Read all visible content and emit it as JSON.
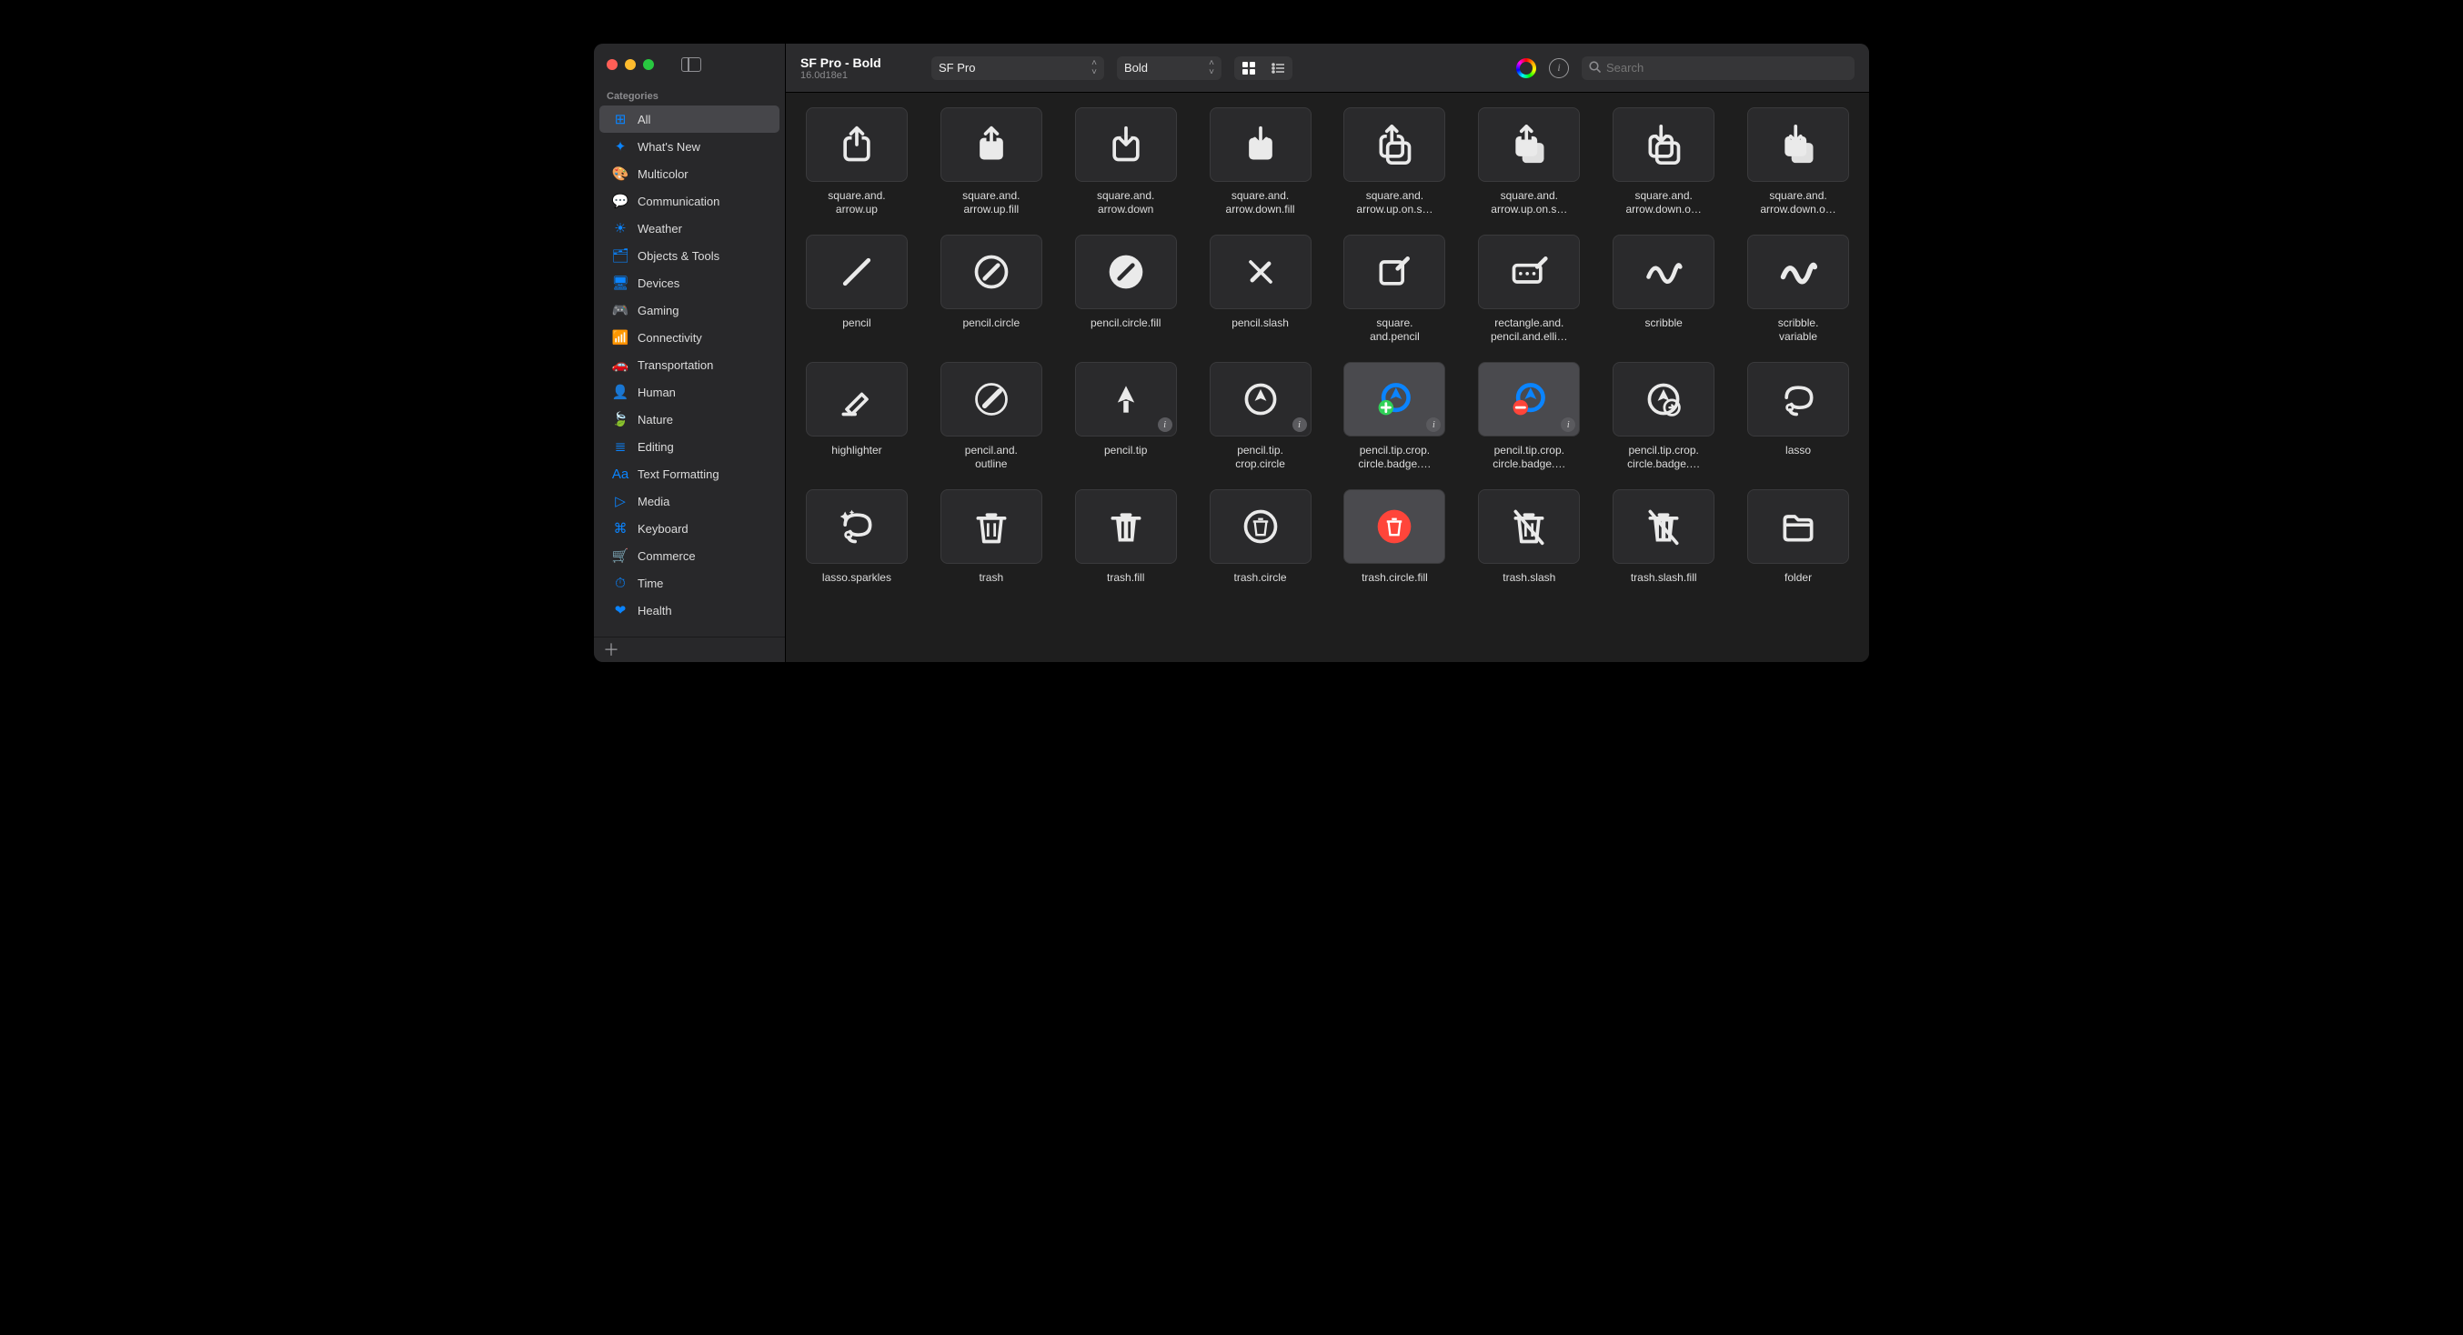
{
  "window": {
    "title": "SF Pro - Bold",
    "subtitle": "16.0d18e1"
  },
  "toolbar": {
    "font": "SF Pro",
    "weight": "Bold",
    "view_mode": "grid",
    "search_placeholder": "Search"
  },
  "sidebar": {
    "section_label": "Categories",
    "items": [
      {
        "id": "all",
        "label": "All",
        "selected": true
      },
      {
        "id": "whats-new",
        "label": "What's New",
        "selected": false
      },
      {
        "id": "multicolor",
        "label": "Multicolor",
        "selected": false
      },
      {
        "id": "communication",
        "label": "Communication",
        "selected": false
      },
      {
        "id": "weather",
        "label": "Weather",
        "selected": false
      },
      {
        "id": "objects-tools",
        "label": "Objects & Tools",
        "selected": false
      },
      {
        "id": "devices",
        "label": "Devices",
        "selected": false
      },
      {
        "id": "gaming",
        "label": "Gaming",
        "selected": false
      },
      {
        "id": "connectivity",
        "label": "Connectivity",
        "selected": false
      },
      {
        "id": "transportation",
        "label": "Transportation",
        "selected": false
      },
      {
        "id": "human",
        "label": "Human",
        "selected": false
      },
      {
        "id": "nature",
        "label": "Nature",
        "selected": false
      },
      {
        "id": "editing",
        "label": "Editing",
        "selected": false
      },
      {
        "id": "text-formatting",
        "label": "Text Formatting",
        "selected": false
      },
      {
        "id": "media",
        "label": "Media",
        "selected": false
      },
      {
        "id": "keyboard",
        "label": "Keyboard",
        "selected": false
      },
      {
        "id": "commerce",
        "label": "Commerce",
        "selected": false
      },
      {
        "id": "time",
        "label": "Time",
        "selected": false
      },
      {
        "id": "health",
        "label": "Health",
        "selected": false
      }
    ]
  },
  "symbols": [
    {
      "name": "square.and.arrow.up",
      "display": "square.and.\narrow.up",
      "icon": "share-up",
      "info": false,
      "selected": false
    },
    {
      "name": "square.and.arrow.up.fill",
      "display": "square.and.\narrow.up.fill",
      "icon": "share-up-fill",
      "info": false,
      "selected": false
    },
    {
      "name": "square.and.arrow.down",
      "display": "square.and.\narrow.down",
      "icon": "share-down",
      "info": false,
      "selected": false
    },
    {
      "name": "square.and.arrow.down.fill",
      "display": "square.and.\narrow.down.fill",
      "icon": "share-down-fill",
      "info": false,
      "selected": false
    },
    {
      "name": "square.and.arrow.up.on.square",
      "display": "square.and.\narrow.up.on.s…",
      "icon": "share-up-stack",
      "info": false,
      "selected": false
    },
    {
      "name": "square.and.arrow.up.on.square.fill",
      "display": "square.and.\narrow.up.on.s…",
      "icon": "share-up-stack-fill",
      "info": false,
      "selected": false
    },
    {
      "name": "square.and.arrow.down.on.square",
      "display": "square.and.\narrow.down.o…",
      "icon": "share-down-stack",
      "info": false,
      "selected": false
    },
    {
      "name": "square.and.arrow.down.on.square.fill",
      "display": "square.and.\narrow.down.o…",
      "icon": "share-down-stack-fill",
      "info": false,
      "selected": false
    },
    {
      "name": "pencil",
      "display": "pencil",
      "icon": "pencil",
      "info": false,
      "selected": false
    },
    {
      "name": "pencil.circle",
      "display": "pencil.circle",
      "icon": "pencil-circle",
      "info": false,
      "selected": false
    },
    {
      "name": "pencil.circle.fill",
      "display": "pencil.circle.fill",
      "icon": "pencil-circle-fill",
      "info": false,
      "selected": false
    },
    {
      "name": "pencil.slash",
      "display": "pencil.slash",
      "icon": "pencil-slash",
      "info": false,
      "selected": false
    },
    {
      "name": "square.and.pencil",
      "display": "square.\nand.pencil",
      "icon": "square-pencil",
      "info": false,
      "selected": false
    },
    {
      "name": "rectangle.and.pencil.and.ellipsis",
      "display": "rectangle.and.\npencil.and.elli…",
      "icon": "rect-pencil-elli",
      "info": false,
      "selected": false
    },
    {
      "name": "scribble",
      "display": "scribble",
      "icon": "scribble",
      "info": false,
      "selected": false
    },
    {
      "name": "scribble.variable",
      "display": "scribble.\nvariable",
      "icon": "scribble-var",
      "info": false,
      "selected": false
    },
    {
      "name": "highlighter",
      "display": "highlighter",
      "icon": "highlighter",
      "info": false,
      "selected": false
    },
    {
      "name": "pencil.and.outline",
      "display": "pencil.and.\noutline",
      "icon": "pencil-outline",
      "info": false,
      "selected": false
    },
    {
      "name": "pencil.tip",
      "display": "pencil.tip",
      "icon": "pencil-tip",
      "info": true,
      "selected": false
    },
    {
      "name": "pencil.tip.crop.circle",
      "display": "pencil.tip.\ncrop.circle",
      "icon": "pt-crop-circle",
      "info": true,
      "selected": false
    },
    {
      "name": "pencil.tip.crop.circle.badge.plus",
      "display": "pencil.tip.crop.\ncircle.badge.…",
      "icon": "pt-crop-plus",
      "info": true,
      "selected": true
    },
    {
      "name": "pencil.tip.crop.circle.badge.minus",
      "display": "pencil.tip.crop.\ncircle.badge.…",
      "icon": "pt-crop-minus",
      "info": true,
      "selected": true
    },
    {
      "name": "pencil.tip.crop.circle.badge.arrow.forward",
      "display": "pencil.tip.crop.\ncircle.badge.…",
      "icon": "pt-crop-arrow",
      "info": false,
      "selected": false
    },
    {
      "name": "lasso",
      "display": "lasso",
      "icon": "lasso",
      "info": false,
      "selected": false
    },
    {
      "name": "lasso.sparkles",
      "display": "lasso.sparkles",
      "icon": "lasso-sparkles",
      "info": false,
      "selected": false
    },
    {
      "name": "trash",
      "display": "trash",
      "icon": "trash",
      "info": false,
      "selected": false
    },
    {
      "name": "trash.fill",
      "display": "trash.fill",
      "icon": "trash-fill",
      "info": false,
      "selected": false
    },
    {
      "name": "trash.circle",
      "display": "trash.circle",
      "icon": "trash-circle",
      "info": false,
      "selected": false
    },
    {
      "name": "trash.circle.fill",
      "display": "trash.circle.fill",
      "icon": "trash-circle-fill",
      "info": false,
      "selected": true
    },
    {
      "name": "trash.slash",
      "display": "trash.slash",
      "icon": "trash-slash",
      "info": false,
      "selected": false
    },
    {
      "name": "trash.slash.fill",
      "display": "trash.slash.fill",
      "icon": "trash-slash-fill",
      "info": false,
      "selected": false
    },
    {
      "name": "folder",
      "display": "folder",
      "icon": "folder",
      "info": false,
      "selected": false
    }
  ]
}
